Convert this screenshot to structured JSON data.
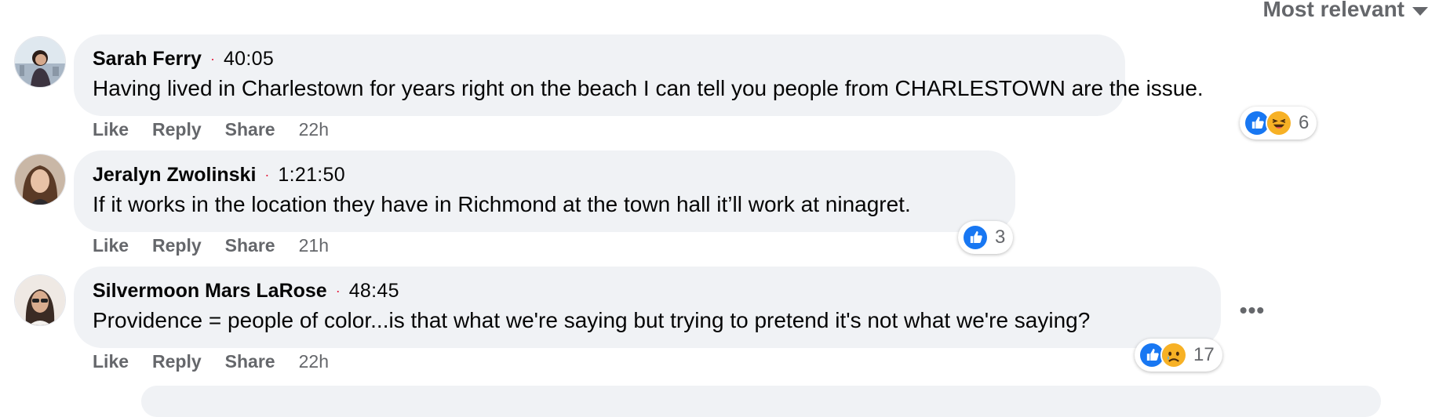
{
  "sort": {
    "label": "Most relevant",
    "icon": "caret-down-icon"
  },
  "comments": [
    {
      "author": "Sarah Ferry",
      "timestamp": "40:05",
      "text": "Having lived in Charlestown for years right on the beach I can tell you people from CHARLESTOWN are the issue.",
      "actions": {
        "like": "Like",
        "reply": "Reply",
        "share": "Share"
      },
      "age": "22h",
      "reactions": {
        "icons": [
          "like-reaction-icon",
          "haha-reaction-icon"
        ],
        "count": "6"
      }
    },
    {
      "author": "Jeralyn Zwolinski",
      "timestamp": "1:21:50",
      "text": "If it works in the location they have in Richmond at the town hall it’ll work at ninagret.",
      "actions": {
        "like": "Like",
        "reply": "Reply",
        "share": "Share"
      },
      "age": "21h",
      "reactions": {
        "icons": [
          "like-reaction-icon"
        ],
        "count": "3"
      }
    },
    {
      "author": "Silvermoon Mars LaRose",
      "timestamp": "48:45",
      "text": "Providence = people of color...is that what we're saying but trying to pretend it's not what we're saying?",
      "actions": {
        "like": "Like",
        "reply": "Reply",
        "share": "Share"
      },
      "age": "22h",
      "reactions": {
        "icons": [
          "like-reaction-icon",
          "sad-reaction-icon"
        ],
        "count": "17"
      },
      "more": "•••"
    }
  ],
  "colors": {
    "bubble": "#f0f2f5",
    "secondary_text": "#65676b",
    "like_blue": "#1877f2",
    "reaction_yellow": "#f7b125",
    "timestamp_dot": "#e41e3f"
  }
}
